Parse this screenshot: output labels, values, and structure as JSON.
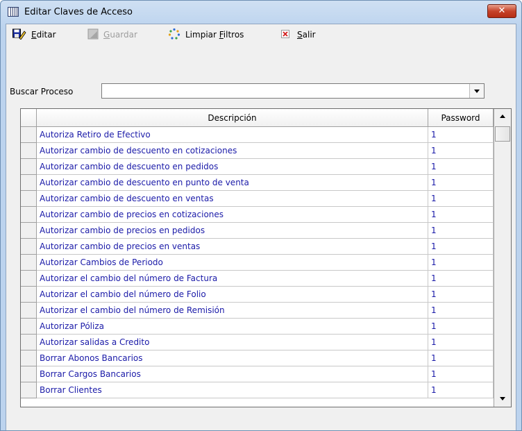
{
  "window": {
    "title": "Editar Claves de Acceso",
    "close_label": "✕"
  },
  "toolbar": {
    "editar": {
      "pre": "",
      "key": "E",
      "post": "ditar",
      "icon": "edit-disk-icon"
    },
    "guardar": {
      "pre": "",
      "key": "G",
      "post": "uardar",
      "icon": "save-icon",
      "enabled": false
    },
    "limpiar": {
      "pre": "Limpiar ",
      "key": "F",
      "post": "iltros",
      "icon": "clear-filter-icon"
    },
    "salir": {
      "pre": "",
      "key": "S",
      "post": "alir",
      "icon": "exit-icon"
    }
  },
  "search": {
    "label": "Buscar Proceso",
    "value": ""
  },
  "grid": {
    "columns": [
      "Descripción",
      "Password"
    ],
    "rows": [
      [
        "Autoriza Retiro de Efectivo",
        "1"
      ],
      [
        "Autorizar cambio de descuento en cotizaciones",
        "1"
      ],
      [
        "Autorizar cambio de descuento en pedidos",
        "1"
      ],
      [
        "Autorizar cambio de descuento en punto de venta",
        "1"
      ],
      [
        "Autorizar cambio de descuento en ventas",
        "1"
      ],
      [
        "Autorizar cambio de precios en cotizaciones",
        "1"
      ],
      [
        "Autorizar cambio de precios en pedidos",
        "1"
      ],
      [
        "Autorizar cambio de precios en ventas",
        "1"
      ],
      [
        "Autorizar Cambios de Periodo",
        "1"
      ],
      [
        "Autorizar el cambio del número de Factura",
        "1"
      ],
      [
        "Autorizar el cambio del número de Folio",
        "1"
      ],
      [
        "Autorizar el cambio del número de Remisión",
        "1"
      ],
      [
        "Autorizar Póliza",
        "1"
      ],
      [
        "Autorizar salidas a Credito",
        "1"
      ],
      [
        "Borrar Abonos Bancarios",
        "1"
      ],
      [
        "Borrar Cargos Bancarios",
        "1"
      ],
      [
        "Borrar Clientes",
        "1"
      ]
    ]
  },
  "colors": {
    "row_text": "#1a1aa8",
    "title_bar": "#bcd3ee",
    "close_button": "#c6432a"
  }
}
